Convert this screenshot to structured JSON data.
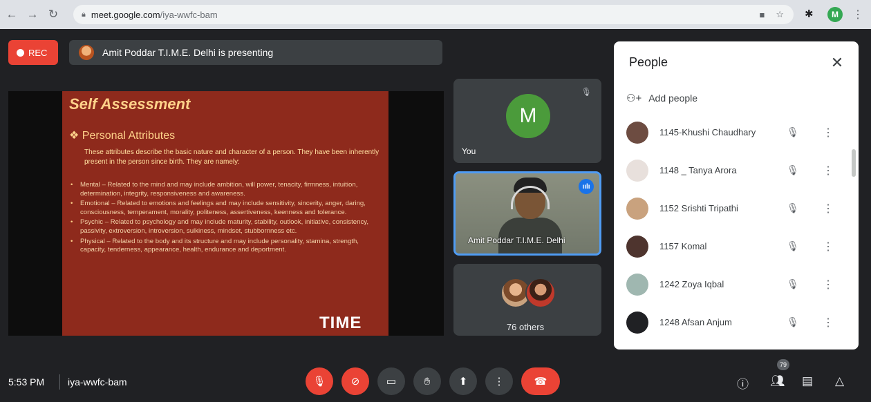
{
  "browser": {
    "back_icon": "arrow-left-icon",
    "forward_icon": "arrow-right-icon",
    "reload_icon": "reload-icon",
    "url_host": "meet.google.com",
    "url_path": "/iya-wwfc-bam",
    "profile_initial": "M",
    "profile_color": "#34a853"
  },
  "meet": {
    "rec_label": "REC",
    "presenting_text": "Amit Poddar T.I.M.E. Delhi is presenting",
    "slide": {
      "title": "Self Assessment",
      "subtitle": "Personal Attributes",
      "intro": "These attributes describe the basic nature and character of a person. They have been inherently present in the person since birth. They are namely:",
      "bullets": [
        "Mental – Related to the mind and may include ambition, will power, tenacity, firmness, intuition, determination, integrity, responsiveness and awareness.",
        "Emotional – Related to emotions and feelings and may include sensitivity, sincerity, anger, daring, consciousness, temperament, morality, politeness, assertiveness, keenness and tolerance.",
        "Psychic – Related to psychology and may include maturity, stability, outlook, initiative, consistency, passivity, extroversion, introversion, sulkiness, mindset, stubbornness etc.",
        "Physical – Related to the body and its structure and may include personality, stamina, strength, capacity, tenderness, appearance, health, endurance and deportment."
      ],
      "logo": "TIME"
    },
    "tiles": {
      "you": {
        "initial": "M",
        "label": "You"
      },
      "presenter": {
        "label": "Amit Poddar T.I.M.E. Delhi"
      },
      "others": {
        "label": "76 others"
      }
    },
    "people_panel": {
      "title": "People",
      "add_people": "Add people",
      "participants": [
        {
          "name": "1145-Khushi Chaudhary",
          "avatar_color": "#6d4c41"
        },
        {
          "name": "1148 _ Tanya Arora",
          "avatar_color": "#e8e0dc"
        },
        {
          "name": "1152 Srishti Tripathi",
          "avatar_color": "#c9a27e"
        },
        {
          "name": "1157 Komal",
          "avatar_color": "#4e342e"
        },
        {
          "name": "1242 Zoya Iqbal",
          "avatar_color": "#9fb7b0"
        },
        {
          "name": "1248 Afsan Anjum",
          "avatar_color": "#202124"
        }
      ]
    },
    "bottom": {
      "time": "5:53 PM",
      "meeting_code": "iya-wwfc-bam",
      "people_count": "79"
    }
  }
}
